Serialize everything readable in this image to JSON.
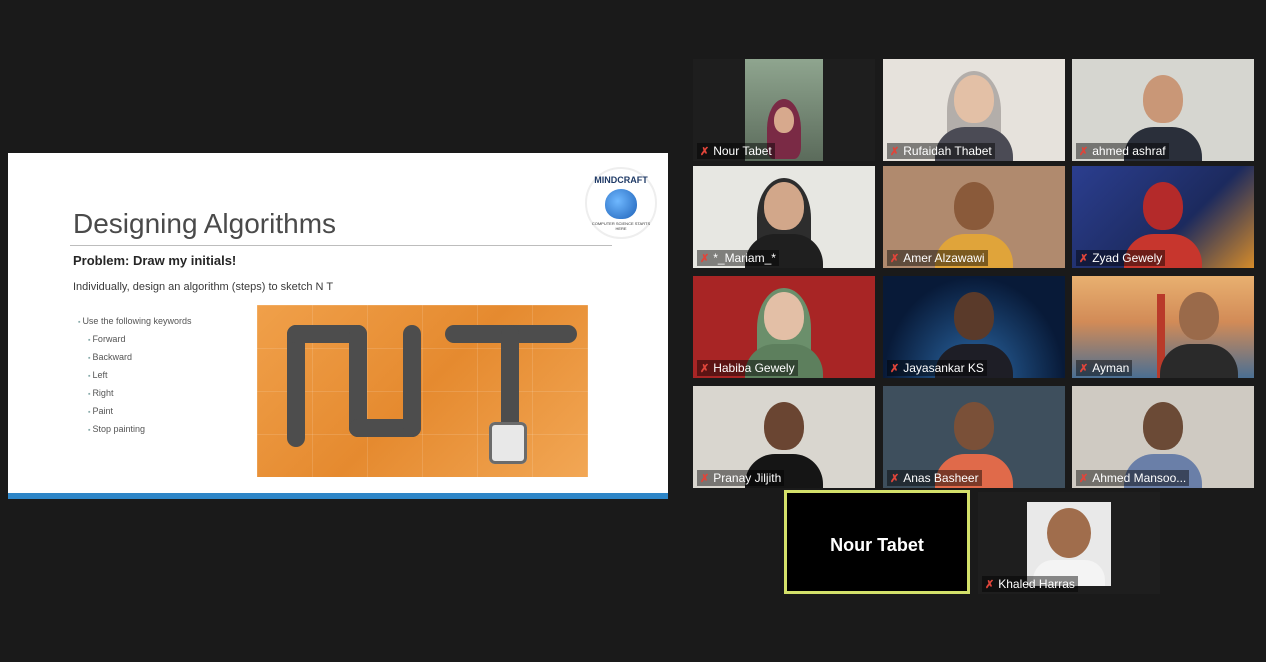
{
  "slide": {
    "title": "Designing Algorithms",
    "subtitle": "Problem: Draw my initials!",
    "instruction": "Individually, design an algorithm (steps) to sketch N T",
    "bullet_heading": "Use the following keywords",
    "keywords": [
      "Forward",
      "Backward",
      "Left",
      "Right",
      "Paint",
      "Stop painting"
    ],
    "logo_text": "MINDCRAFT",
    "logo_tagline": "COMPUTER SCIENCE STARTS HERE",
    "accent_color": "#2e86c8"
  },
  "participants": [
    {
      "name": "Nour Tabet",
      "muted": true
    },
    {
      "name": "Rufaidah Thabet",
      "muted": true
    },
    {
      "name": "ahmed ashraf",
      "muted": true
    },
    {
      "name": "*_Mariam_*",
      "muted": true
    },
    {
      "name": "Amer Alzawawi",
      "muted": true
    },
    {
      "name": "Zyad Gewely",
      "muted": true
    },
    {
      "name": "Habiba Gewely",
      "muted": true
    },
    {
      "name": "Jayasankar KS",
      "muted": true
    },
    {
      "name": "Ayman",
      "muted": true
    },
    {
      "name": "Pranay Jiljith",
      "muted": true
    },
    {
      "name": "Anas Basheer",
      "muted": true
    },
    {
      "name": "Ahmed Mansoo...",
      "muted": true
    },
    {
      "name": "Khaled Harras",
      "muted": true
    }
  ],
  "active_speaker": {
    "name": "Nour Tabet"
  },
  "icons": {
    "muted": "muted-mic-icon"
  }
}
